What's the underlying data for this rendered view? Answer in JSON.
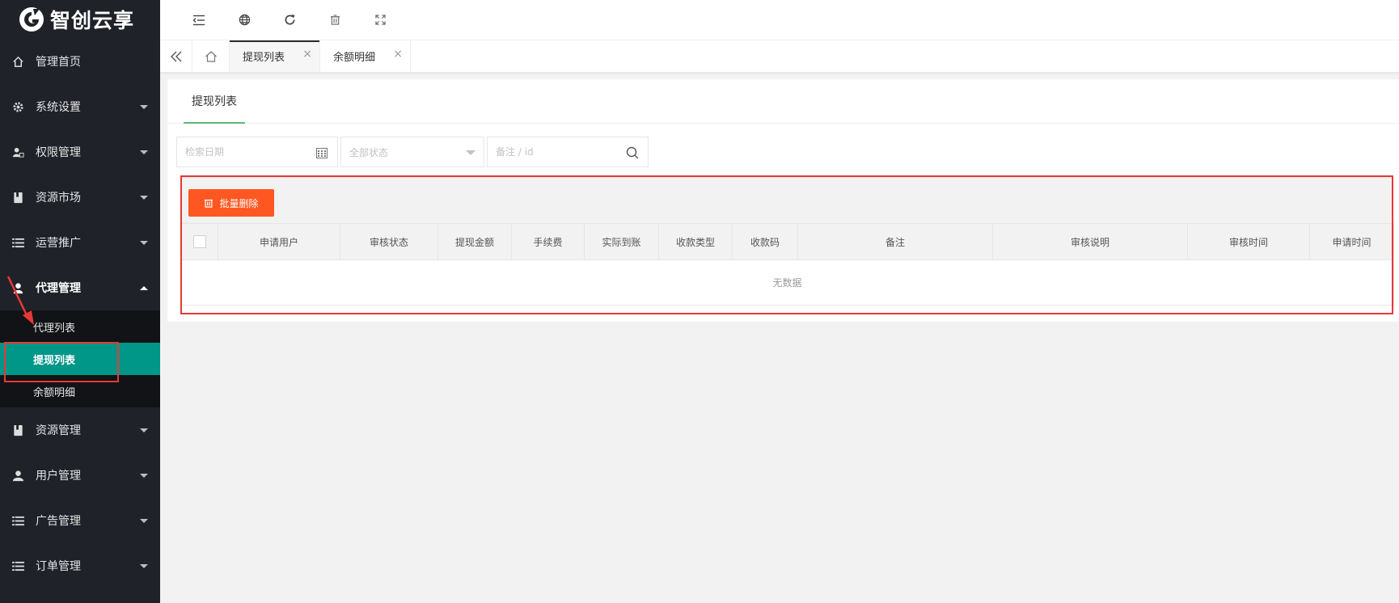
{
  "brand": {
    "name": "智创云享"
  },
  "colors": {
    "sidebar_bg": "#20222a",
    "accent": "#009688",
    "danger": "#ff5722",
    "annotation": "#e53935"
  },
  "sidebar": {
    "items": [
      {
        "label": "管理首页",
        "icon": "home-icon"
      },
      {
        "label": "系统设置",
        "icon": "gear-icon"
      },
      {
        "label": "权限管理",
        "icon": "user-lock-icon"
      },
      {
        "label": "资源市场",
        "icon": "book-icon"
      },
      {
        "label": "运营推广",
        "icon": "list-icon"
      },
      {
        "label": "代理管理",
        "icon": "agent-icon",
        "expanded": true
      },
      {
        "label": "资源管理",
        "icon": "book-icon"
      },
      {
        "label": "用户管理",
        "icon": "user-icon"
      },
      {
        "label": "广告管理",
        "icon": "list-icon"
      },
      {
        "label": "订单管理",
        "icon": "list-icon"
      }
    ],
    "sub_items": [
      {
        "label": "代理列表"
      },
      {
        "label": "提现列表",
        "active": true
      },
      {
        "label": "余额明细"
      }
    ]
  },
  "topbar": {
    "buttons": [
      "menu-shrink-icon",
      "globe-icon",
      "refresh-icon",
      "trash-icon",
      "fullscreen-icon"
    ]
  },
  "tabs": [
    {
      "label": "提现列表",
      "active": true,
      "close": "×"
    },
    {
      "label": "余额明细",
      "active": false,
      "close": "×"
    }
  ],
  "card": {
    "tab_label": "提现列表"
  },
  "filters": {
    "date_placeholder": "检索日期",
    "status_selected": "全部状态",
    "search_placeholder": "备注 / id"
  },
  "toolbar": {
    "batch_delete_label": "批量删除"
  },
  "table": {
    "columns": [
      "申请用户",
      "审核状态",
      "提现金额",
      "手续费",
      "实际到账",
      "收款类型",
      "收款码",
      "备注",
      "审核说明",
      "审核时间",
      "申请时间"
    ],
    "empty_text": "无数据"
  }
}
